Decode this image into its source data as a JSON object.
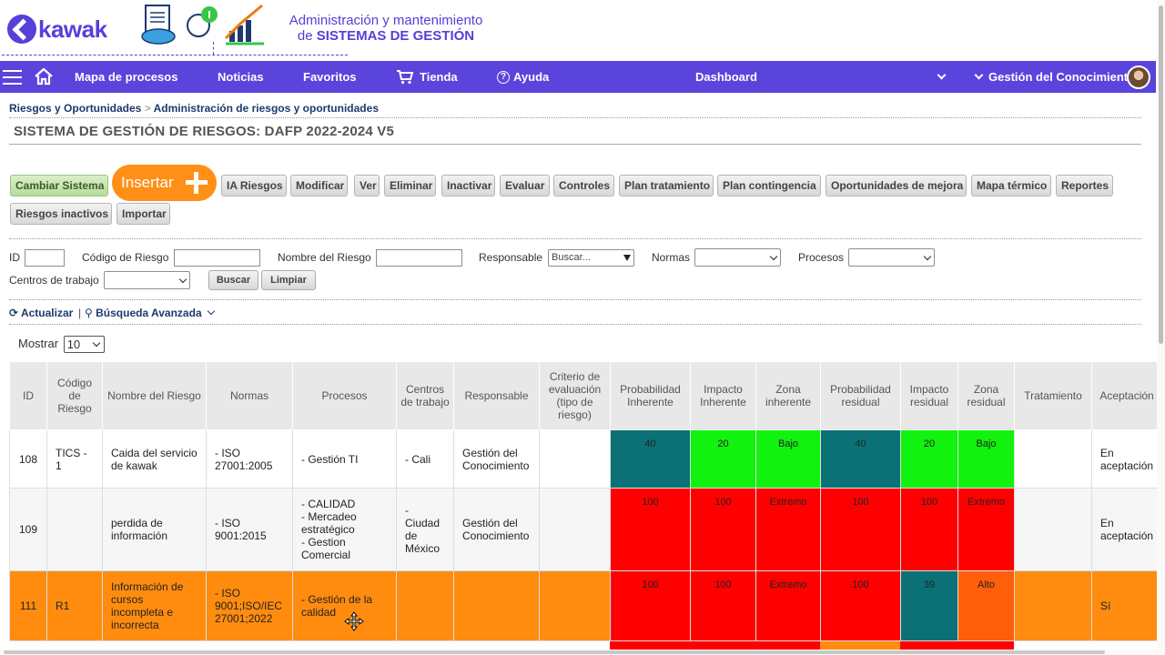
{
  "brand": {
    "logo_text": "kawak",
    "tagline_line1": "Administración y mantenimiento",
    "tagline_line2_prefix": "de ",
    "tagline_line2_bold": "SISTEMAS DE GESTIÓN",
    "accent": "#5a44dc"
  },
  "nav": {
    "items": [
      "Mapa de procesos",
      "Noticias",
      "Favoritos",
      "Tienda",
      "Ayuda",
      "Dashboard"
    ],
    "user": "Gestión del Conocimiento",
    "icons": [
      "menu-icon",
      "home-icon",
      "cart-icon",
      "help-icon",
      "chevron-down-icon"
    ]
  },
  "breadcrumb": {
    "parent": "Riesgos y Oportunidades",
    "separator": ">",
    "current": "Administración de riesgos y oportunidades"
  },
  "page_title": "SISTEMA DE GESTIÓN DE RIESGOS: DAFP 2022-2024 V5",
  "toolbar": {
    "cambiar": "Cambiar Sistema",
    "insertar": "Insertar",
    "buttons": [
      "IA Riesgos",
      "Modificar",
      "Ver",
      "Eliminar",
      "Inactivar",
      "Evaluar",
      "Controles",
      "Plan tratamiento",
      "Plan contingencia",
      "Oportunidades de mejora",
      "Mapa térmico",
      "Reportes"
    ],
    "row2": [
      "Riesgos inactivos",
      "Importar"
    ]
  },
  "filters": {
    "id_label": "ID",
    "codigo_label": "Código de Riesgo",
    "nombre_label": "Nombre del Riesgo",
    "responsable_label": "Responsable",
    "responsable_placeholder": "Buscar...",
    "normas_label": "Normas",
    "procesos_label": "Procesos",
    "centros_label": "Centros de trabajo",
    "buscar": "Buscar",
    "limpiar": "Limpiar"
  },
  "links": {
    "actualizar": "Actualizar",
    "separator": "|",
    "busqueda": "Búsqueda Avanzada"
  },
  "paging": {
    "mostrar_label": "Mostrar",
    "page_size": "10"
  },
  "table": {
    "headers": [
      "ID",
      "Código de Riesgo",
      "Nombre del Riesgo",
      "Normas",
      "Procesos",
      "Centros de trabajo",
      "Responsable",
      "Criterio de evaluación (tipo de riesgo)",
      "Probabilidad Inherente",
      "Impacto Inherente",
      "Zona inherente",
      "Probabilidad residual",
      "Impacto residual",
      "Zona residual",
      "Tratamiento",
      "Aceptación"
    ],
    "rows": [
      {
        "id": "108",
        "codigo": "TICS - 1",
        "nombre": "Caida del servicio de kawak",
        "normas": [
          "- ISO 27001:2005"
        ],
        "procesos": [
          "- Gestión TI"
        ],
        "centros": "- Cali",
        "responsable": "Gestión del Conocimiento",
        "criterio": "",
        "prob_inh": "40",
        "imp_inh": "20",
        "zona_inh": "Bajo",
        "prob_res": "40",
        "imp_res": "20",
        "zona_res": "Bajo",
        "tratamiento": "",
        "aceptacion": "En aceptación"
      },
      {
        "id": "109",
        "codigo": "",
        "nombre": "perdida de información",
        "normas": [
          "- ISO 9001:2015"
        ],
        "procesos": [
          "- CALIDAD",
          "- Mercadeo estratégico",
          "- Gestion Comercial"
        ],
        "centros": "- Ciudad de México",
        "responsable": "Gestión del Conocimiento",
        "criterio": "",
        "prob_inh": "100",
        "imp_inh": "100",
        "zona_inh": "Extremo",
        "prob_res": "100",
        "imp_res": "100",
        "zona_res": "Extremo",
        "tratamiento": "",
        "aceptacion": "En aceptación"
      },
      {
        "id": "111",
        "codigo": "R1",
        "nombre": "Información de cursos incompleta e incorrecta",
        "normas": [
          "- ISO 9001;ISO/IEC 27001;2022"
        ],
        "procesos": [
          "- Gestión de la calidad"
        ],
        "centros": "",
        "responsable": "",
        "criterio": "",
        "prob_inh": "100",
        "imp_inh": "100",
        "zona_inh": "Extremo",
        "prob_res": "100",
        "imp_res": "39",
        "zona_res": "Alto",
        "tratamiento": "",
        "aceptacion": "Sí"
      }
    ]
  },
  "colors": {
    "teal": "#0b7177",
    "green": "#12f20f",
    "red": "#ff0000",
    "orange_row": "#ff8c0f",
    "alto": "#ff5f0a"
  }
}
